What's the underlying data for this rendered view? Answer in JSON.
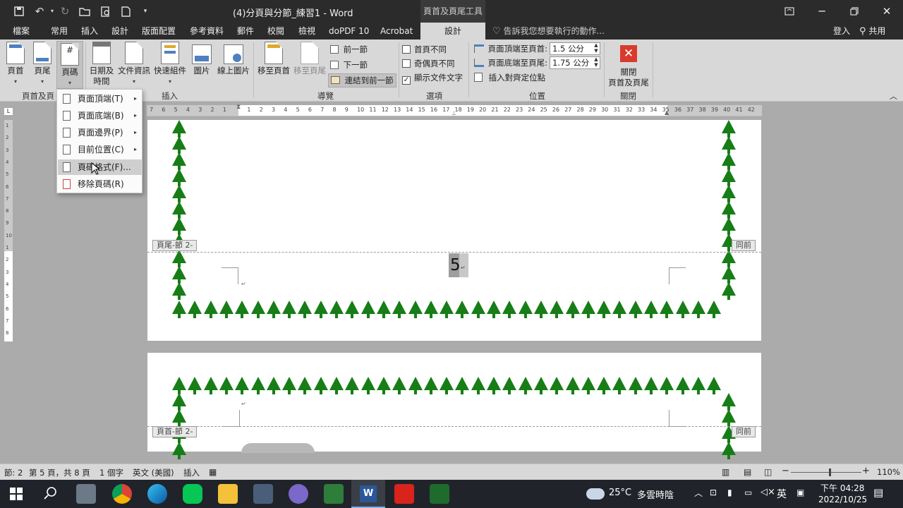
{
  "titlebar": {
    "document_title": "(4)分頁與分節_練習1 - Word",
    "context_tab_group": "頁首及頁尾工具"
  },
  "tabs": [
    "檔案",
    "常用",
    "插入",
    "設計",
    "版面配置",
    "參考資料",
    "郵件",
    "校閱",
    "檢視",
    "doPDF 10",
    "Acrobat"
  ],
  "context_tab": "設計",
  "tell_me_placeholder": "告訴我您想要執行的動作...",
  "account": {
    "sign_in": "登入",
    "share": "共用"
  },
  "ribbon": {
    "btn_header": "頁首",
    "btn_footer": "頁尾",
    "btn_page_number": "頁碼",
    "btn_date_time_1": "日期及",
    "btn_date_time_2": "時間",
    "btn_doc_info": "文件資訊",
    "btn_quick_parts": "快速組件",
    "btn_picture": "圖片",
    "btn_online_picture": "線上圖片",
    "btn_goto_header": "移至頁首",
    "btn_goto_footer": "移至頁尾",
    "nav_previous": "前一節",
    "nav_next": "下一節",
    "nav_link_previous": "連結到前一節",
    "opt_different_first": "首頁不同",
    "opt_different_odd_even": "奇偶頁不同",
    "opt_show_doc_text": "顯示文件文字",
    "pos_header_from_top": "頁面頂端至頁首:",
    "pos_header_value": "1.5 公分",
    "pos_footer_from_bottom": "頁面底端至頁尾:",
    "pos_footer_value": "1.75 公分",
    "pos_insert_align_tab": "插入對齊定位點",
    "btn_close_1": "關閉",
    "btn_close_2": "頁首及頁尾",
    "group_header_footer": "頁首及頁",
    "group_insert": "插入",
    "group_navigation": "導覽",
    "group_options": "選項",
    "group_position": "位置",
    "group_close": "關閉"
  },
  "dropdown_menu": {
    "items": [
      {
        "label": "頁面頂端(T)",
        "submenu": true
      },
      {
        "label": "頁面底端(B)",
        "submenu": true
      },
      {
        "label": "頁面邊界(P)",
        "submenu": true
      },
      {
        "label": "目前位置(C)",
        "submenu": true
      },
      {
        "label": "頁碼格式(F)...",
        "submenu": false
      },
      {
        "label": "移除頁碼(R)",
        "submenu": false
      }
    ],
    "highlighted_index": 4
  },
  "ruler": {
    "horizontal_ticks": [
      "7",
      "6",
      "5",
      "4",
      "3",
      "2",
      "1",
      "",
      "1",
      "2",
      "3",
      "4",
      "5",
      "6",
      "7",
      "8",
      "9",
      "10",
      "11",
      "12",
      "13",
      "14",
      "15",
      "16",
      "17",
      "18",
      "19",
      "20",
      "21",
      "22",
      "23",
      "24",
      "25",
      "26",
      "27",
      "28",
      "29",
      "30",
      "31",
      "32",
      "33",
      "34",
      "35",
      "36",
      "37",
      "38",
      "39",
      "40",
      "41",
      "42"
    ],
    "vertical_ticks": [
      "1",
      "2",
      "3",
      "4",
      "5",
      "6",
      "7",
      "8",
      "9",
      "10",
      "1",
      "2",
      "3",
      "4",
      "5",
      "6",
      "7",
      "8"
    ]
  },
  "document": {
    "footer_tag": "頁尾-節 2-",
    "header_tag": "頁首-節 2-",
    "same_as_previous": "同前",
    "page_number": "5"
  },
  "status": {
    "section": "節: 2",
    "page": "第 5 頁，共 8 頁",
    "words": "1 個字",
    "language": "英文 (美國)",
    "insert_mode": "插入",
    "zoom": "110%",
    "zoom_fraction": 0.55
  },
  "taskbar": {
    "weather_temp": "25°C",
    "weather_desc": "多雲時陰",
    "ime": "英",
    "time": "下午 04:28",
    "date": "2022/10/25"
  },
  "colors": {
    "title_bg": "#2b2b2b",
    "ribbon_bg": "#d8d8d8",
    "canvas_bg": "#ababab",
    "tree_green": "#177d17",
    "close_red": "#d83b2b",
    "taskbar_bg": "#20242a"
  }
}
